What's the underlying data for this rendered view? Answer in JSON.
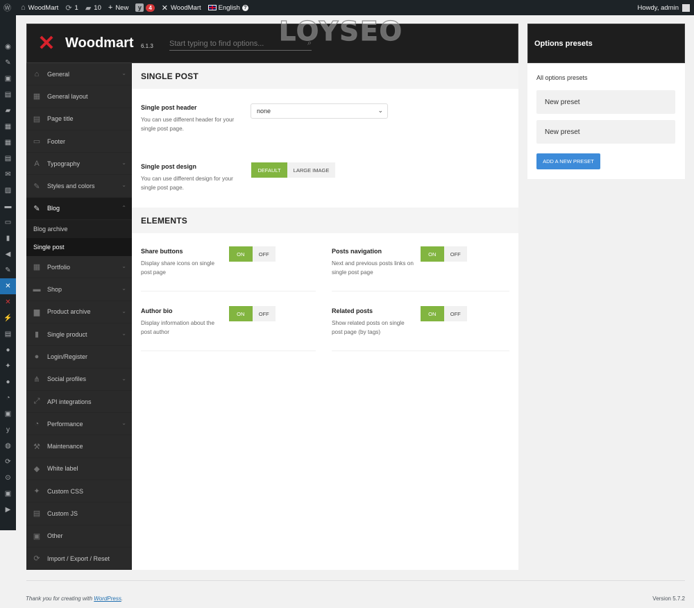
{
  "adminbar": {
    "site_name": "WoodMart",
    "updates_count": "1",
    "comments_count": "10",
    "new_label": "New",
    "yoast_badge": "4",
    "woodmart_label": "WoodMart",
    "language_label": "English",
    "howdy": "Howdy, admin"
  },
  "panel": {
    "brand": "Woodmart",
    "version": "6.1.3",
    "search_placeholder": "Start typing to find options..."
  },
  "watermark": "LOYSEO",
  "nav": {
    "items": [
      {
        "label": "General",
        "icon": "home-icon"
      },
      {
        "label": "General layout",
        "icon": "layout-icon"
      },
      {
        "label": "Page title",
        "icon": "page-title-icon"
      },
      {
        "label": "Footer",
        "icon": "footer-icon"
      },
      {
        "label": "Typography",
        "icon": "typography-icon"
      },
      {
        "label": "Styles and colors",
        "icon": "brush-icon"
      },
      {
        "label": "Blog",
        "icon": "blog-icon"
      }
    ],
    "blog_sub": [
      {
        "label": "Blog archive"
      },
      {
        "label": "Single post"
      }
    ],
    "items_after": [
      {
        "label": "Portfolio"
      },
      {
        "label": "Shop"
      },
      {
        "label": "Product archive"
      },
      {
        "label": "Single product"
      },
      {
        "label": "Login/Register"
      },
      {
        "label": "Social profiles"
      },
      {
        "label": "API integrations"
      },
      {
        "label": "Performance"
      },
      {
        "label": "Maintenance"
      },
      {
        "label": "White label"
      },
      {
        "label": "Custom CSS"
      },
      {
        "label": "Custom JS"
      },
      {
        "label": "Other"
      },
      {
        "label": "Import / Export / Reset"
      }
    ]
  },
  "single_post": {
    "section_title": "SINGLE POST",
    "header": {
      "title": "Single post header",
      "desc": "You can use different header for your single post page.",
      "value": "none"
    },
    "design": {
      "title": "Single post design",
      "desc": "You can use different design for your single post page.",
      "options": [
        "DEFAULT",
        "LARGE IMAGE"
      ],
      "selected": "DEFAULT"
    }
  },
  "elements": {
    "section_title": "ELEMENTS",
    "share": {
      "title": "Share buttons",
      "desc": "Display share icons on single post page",
      "on": "ON",
      "off": "OFF"
    },
    "nav": {
      "title": "Posts navigation",
      "desc": "Next and previous posts links on single post page",
      "on": "ON",
      "off": "OFF"
    },
    "author": {
      "title": "Author bio",
      "desc": "Display information about the post author",
      "on": "ON",
      "off": "OFF"
    },
    "related": {
      "title": "Related posts",
      "desc": "Show related posts on single post page (by tags)",
      "on": "ON",
      "off": "OFF"
    }
  },
  "presets": {
    "header": "Options presets",
    "label": "All options presets",
    "items": [
      "New preset",
      "New preset"
    ],
    "add_button": "ADD A NEW PRESET"
  },
  "footer": {
    "thanks_prefix": "Thank you for creating with",
    "thanks_link": "WordPress",
    "thanks_suffix": ".",
    "version": "Version 5.7.2"
  },
  "colors": {
    "toggle_on": "#82b540",
    "button_blue": "#3d8bd9",
    "brand_red": "#d8222c",
    "admin_bar": "#1d2327"
  }
}
